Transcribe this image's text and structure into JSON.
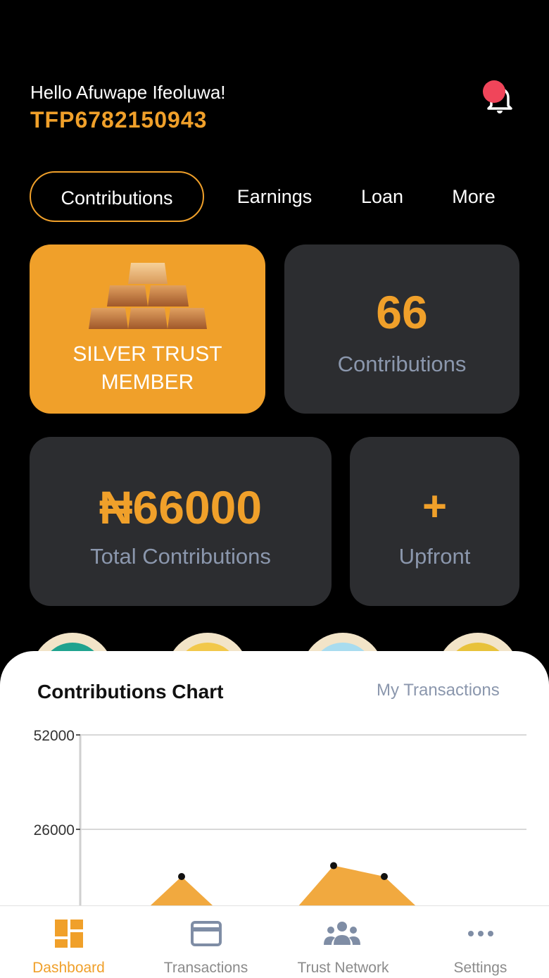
{
  "header": {
    "greeting": "Hello Afuwape Ifeoluwa!",
    "member_id": "TFP6782150943"
  },
  "tabs": [
    {
      "label": "Contributions",
      "active": true
    },
    {
      "label": "Earnings",
      "active": false
    },
    {
      "label": "Loan",
      "active": false
    },
    {
      "label": "More",
      "active": false
    }
  ],
  "cards": {
    "tier": {
      "label_line1": "SILVER TRUST",
      "label_line2": "MEMBER"
    },
    "count": {
      "value": "66",
      "label": "Contributions"
    },
    "total": {
      "value": "₦66000",
      "label": "Total Contributions"
    },
    "upfront": {
      "symbol": "+",
      "label": "Upfront"
    }
  },
  "chart_section": {
    "title": "Contributions Chart",
    "link": "My Transactions"
  },
  "chart_data": {
    "type": "area",
    "title": "Contributions Chart",
    "xlabel": "",
    "ylabel": "",
    "ylim": [
      0,
      52000
    ],
    "yticks": [
      "52000",
      "26000"
    ],
    "x": [
      1,
      2,
      3,
      4,
      5,
      6,
      7
    ],
    "values": [
      0,
      13000,
      0,
      0,
      16000,
      13000,
      0
    ],
    "visible_points": [
      1,
      4,
      5
    ],
    "grid": true,
    "color": "#f0a02a"
  },
  "bottom_nav": [
    {
      "label": "Dashboard",
      "icon": "dashboard-icon",
      "active": true
    },
    {
      "label": "Transactions",
      "icon": "card-icon",
      "active": false
    },
    {
      "label": "Trust Network",
      "icon": "people-icon",
      "active": false
    },
    {
      "label": "Settings",
      "icon": "more-dots-icon",
      "active": false
    }
  ],
  "colors": {
    "accent": "#f0a02a",
    "card": "#2c2d30",
    "muted": "#8b97ad",
    "notification": "#f0455a"
  }
}
